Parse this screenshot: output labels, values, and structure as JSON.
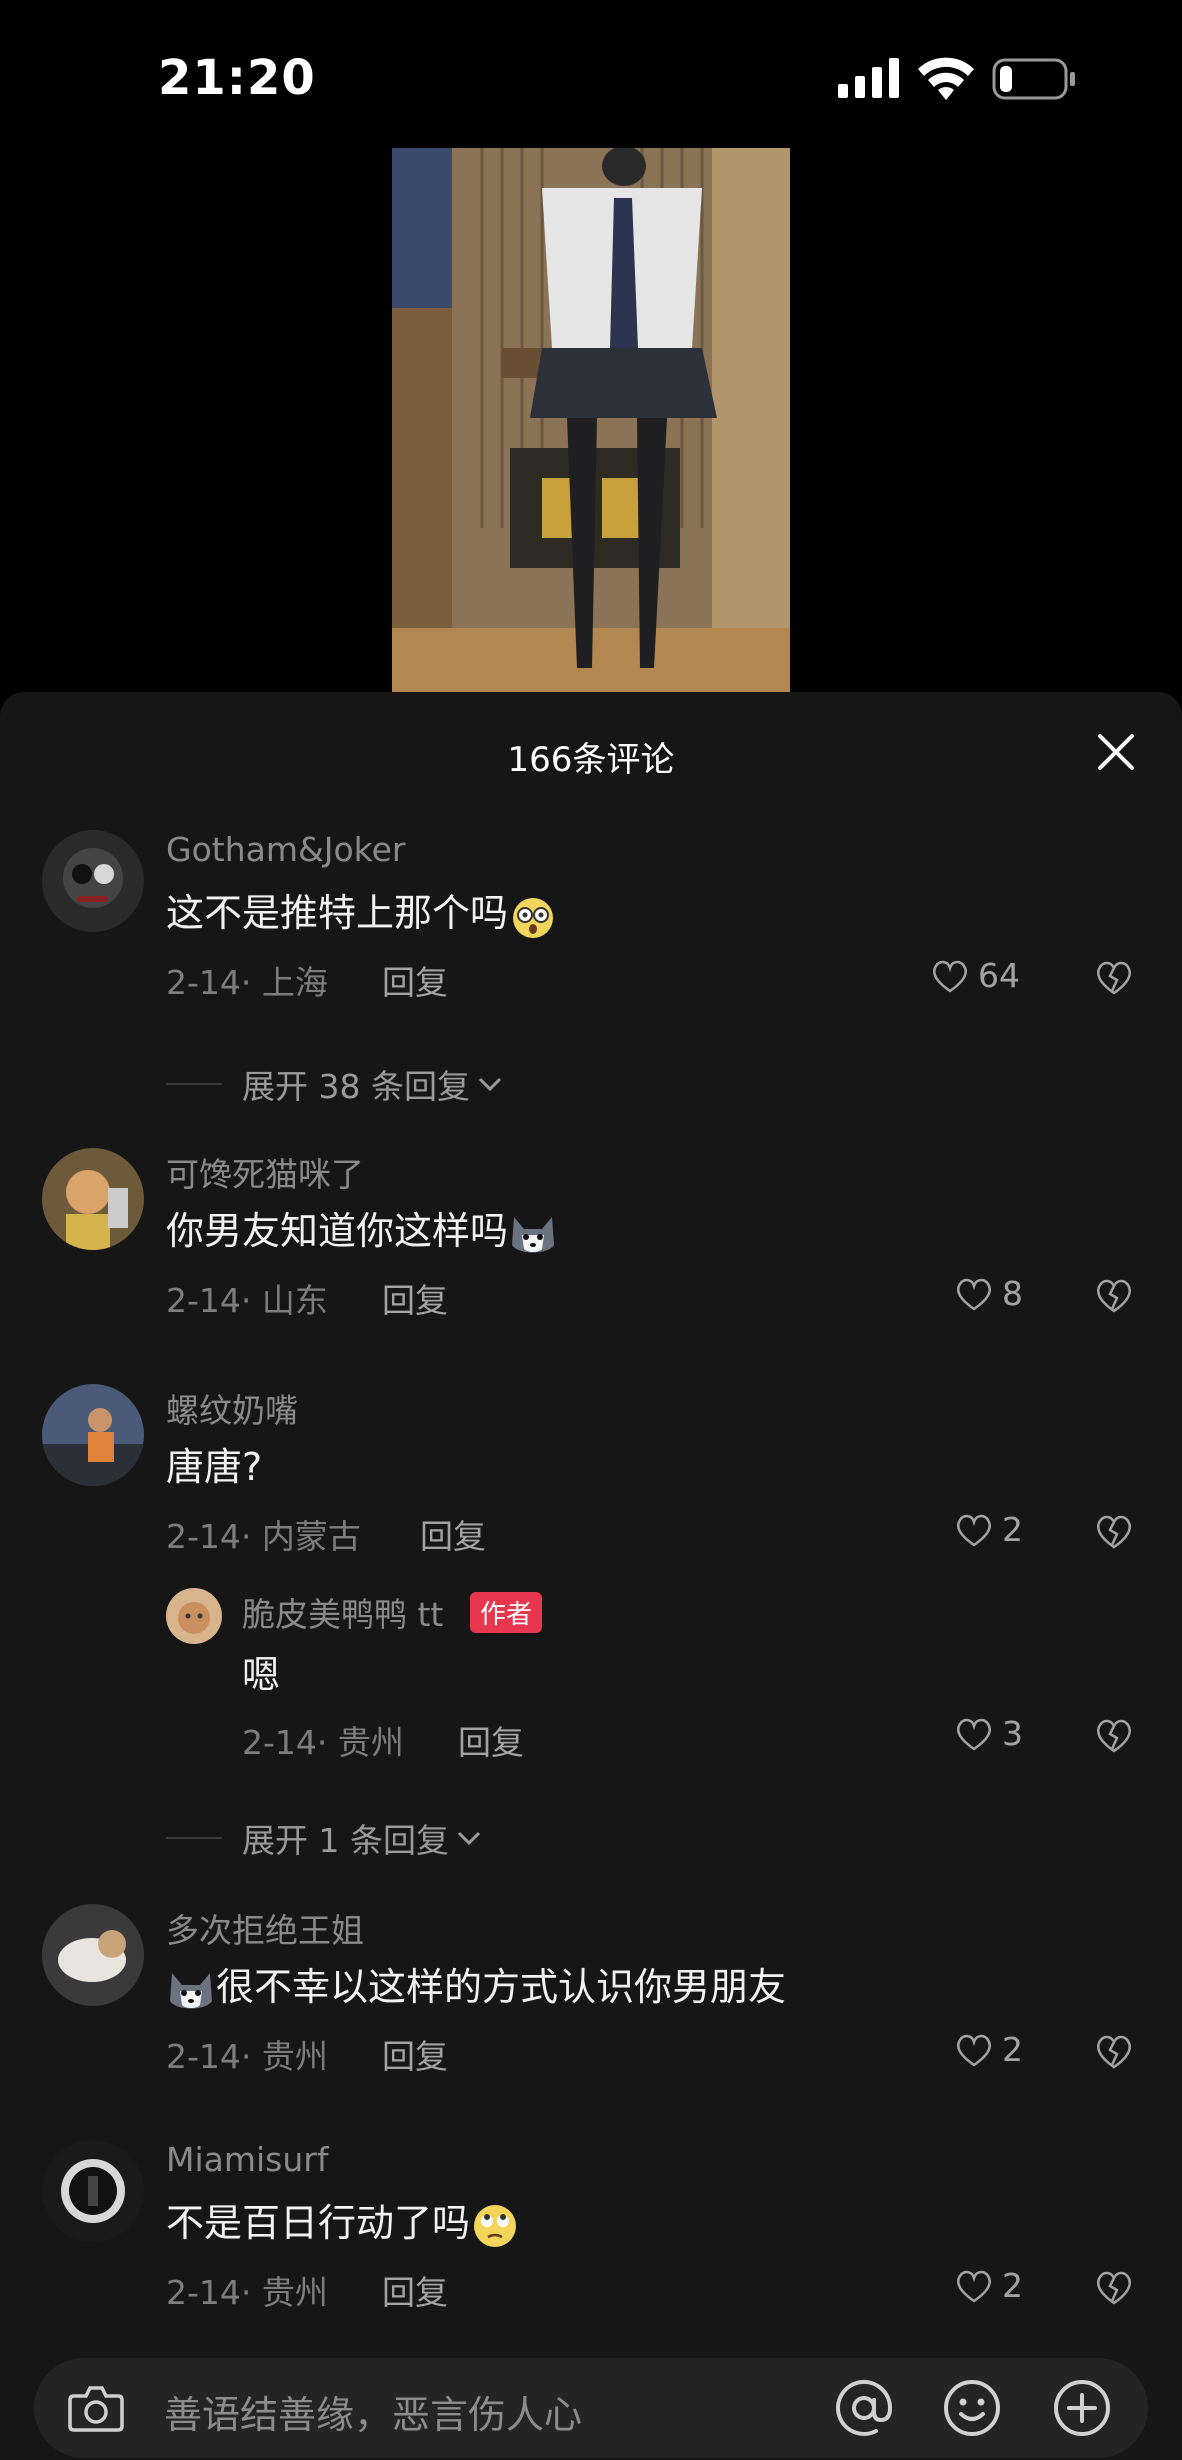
{
  "status_bar": {
    "time": "21:20",
    "battery_level": 0.2
  },
  "video": {
    "icon": "video-thumbnail"
  },
  "comments_sheet": {
    "title": "166条评论",
    "close_icon": "close-icon",
    "reply_label": "回复",
    "comments": [
      {
        "username": "Gotham&Joker",
        "text": "这不是推特上那个吗",
        "emoji": "dizzy-face-emoji",
        "meta": "2-14· 上海",
        "likes": "64",
        "expand": "展开 38 条回复"
      },
      {
        "username": "可馋死猫咪了",
        "text": "你男友知道你这样吗",
        "emoji": "husky-emoji",
        "meta": "2-14· 山东",
        "likes": "8"
      },
      {
        "username": "螺纹奶嘴",
        "text": "唐唐?",
        "meta": "2-14· 内蒙古",
        "likes": "2",
        "replies": [
          {
            "username": "脆皮美鸭鸭 tt",
            "badge": "作者",
            "text": "嗯",
            "meta": "2-14· 贵州",
            "likes": "3"
          }
        ],
        "expand": "展开 1 条回复"
      },
      {
        "username": "多次拒绝王姐",
        "text": "很不幸以这样的方式认识你男朋友",
        "emoji": "husky-emoji",
        "meta": "2-14· 贵州",
        "likes": "2"
      },
      {
        "username": "Miamisurf",
        "text": "不是百日行动了吗",
        "emoji": "eye-roll-emoji",
        "meta": "2-14· 贵州",
        "likes": "2"
      }
    ]
  },
  "input_bar": {
    "placeholder": "善语结善缘，恶言伤人心",
    "icons": [
      "camera-icon",
      "at-icon",
      "emoji-icon",
      "plus-icon"
    ]
  }
}
